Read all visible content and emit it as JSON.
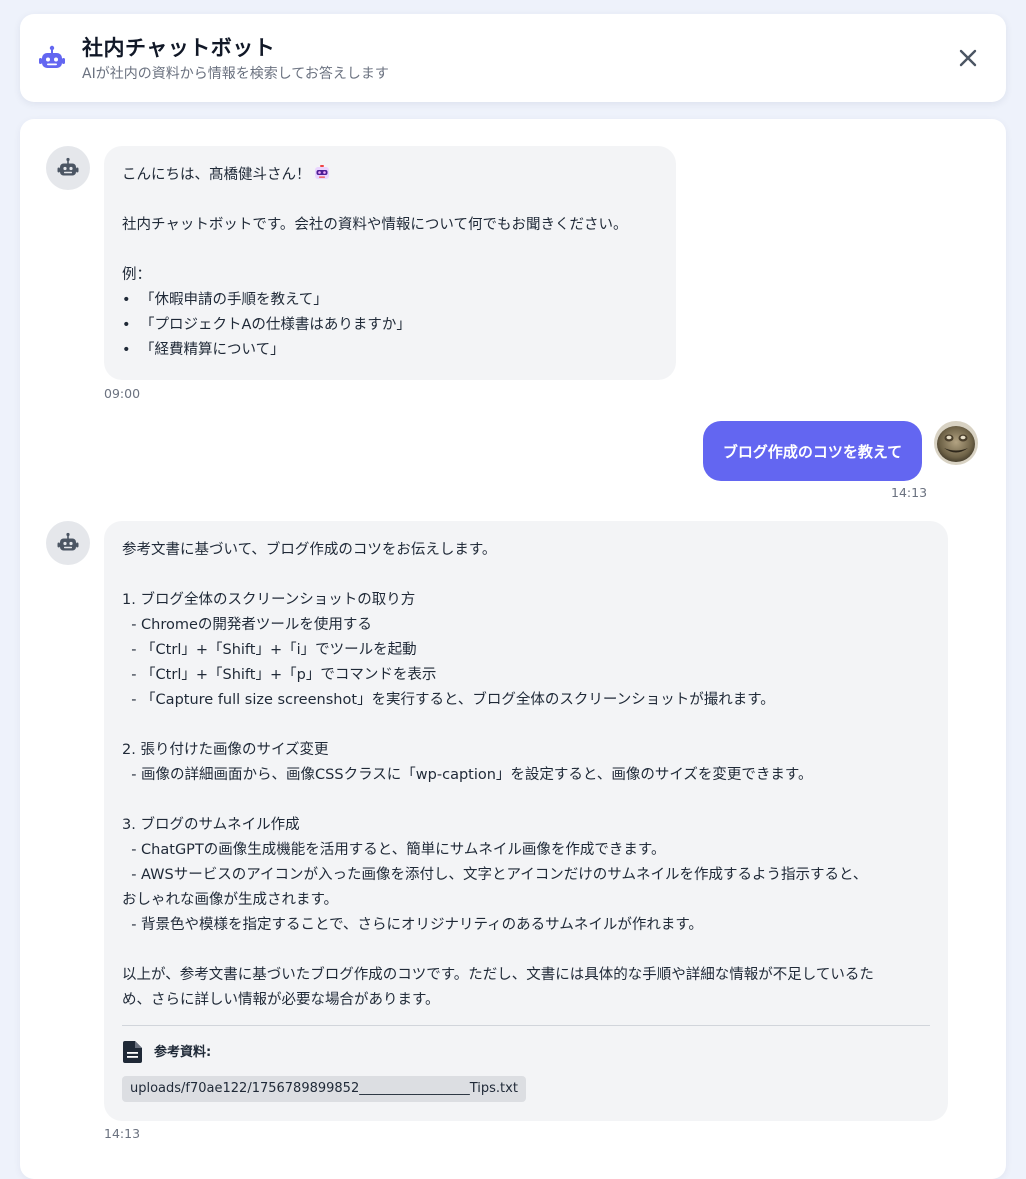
{
  "header": {
    "title": "社内チャットボット",
    "subtitle": "AIが社内の資料から情報を検索してお答えします"
  },
  "messages": [
    {
      "sender": "bot",
      "greeting": "こんにちは、髙橋健斗さん！",
      "intro": "社内チャットボットです。会社の資料や情報について何でもお聞きください。",
      "example_label": "例：",
      "examples": [
        "「休暇申請の手順を教えて」",
        "「プロジェクトAの仕様書はありますか」",
        "「経費精算について」"
      ],
      "time": "09:00"
    },
    {
      "sender": "user",
      "text": "ブログ作成のコツを教えて",
      "time": "14:13"
    },
    {
      "sender": "bot",
      "lines": [
        "参考文書に基づいて、ブログ作成のコツをお伝えします。",
        "",
        "1. ブログ全体のスクリーンショットの取り方",
        "  - Chromeの開発者ツールを使用する",
        "  - 「Ctrl」+「Shift」+「i」でツールを起動",
        "  - 「Ctrl」+「Shift」+「p」でコマンドを表示",
        "  - 「Capture full size screenshot」を実行すると、ブログ全体のスクリーンショットが撮れます。",
        "",
        "2. 張り付けた画像のサイズ変更",
        "  - 画像の詳細画面から、画像CSSクラスに「wp-caption」を設定すると、画像のサイズを変更できます。",
        "",
        "3. ブログのサムネイル作成",
        "  - ChatGPTの画像生成機能を活用すると、簡単にサムネイル画像を作成できます。",
        "  - AWSサービスのアイコンが入った画像を添付し、文字とアイコンだけのサムネイルを作成するよう指示すると、",
        "おしゃれな画像が生成されます。",
        "  - 背景色や模様を指定することで、さらにオリジナリティのあるサムネイルが作れます。",
        "",
        "以上が、参考文書に基づいたブログ作成のコツです。ただし、文書には具体的な手順や詳細な情報が不足しているた",
        "め、さらに詳しい情報が必要な場合があります。"
      ],
      "reference_label": "参考資料:",
      "reference_file": "uploads/f70ae122/1756789899852_________________Tips.txt",
      "time": "14:13"
    }
  ],
  "icons": {
    "header": "robot-icon",
    "close": "close-icon",
    "bot_avatar": "robot-icon",
    "reference": "document-icon",
    "emoji": "robot-emoji-icon"
  },
  "colors": {
    "accent": "#6366f1",
    "bot_bubble": "#f3f4f6",
    "background": "#eef2fb"
  }
}
